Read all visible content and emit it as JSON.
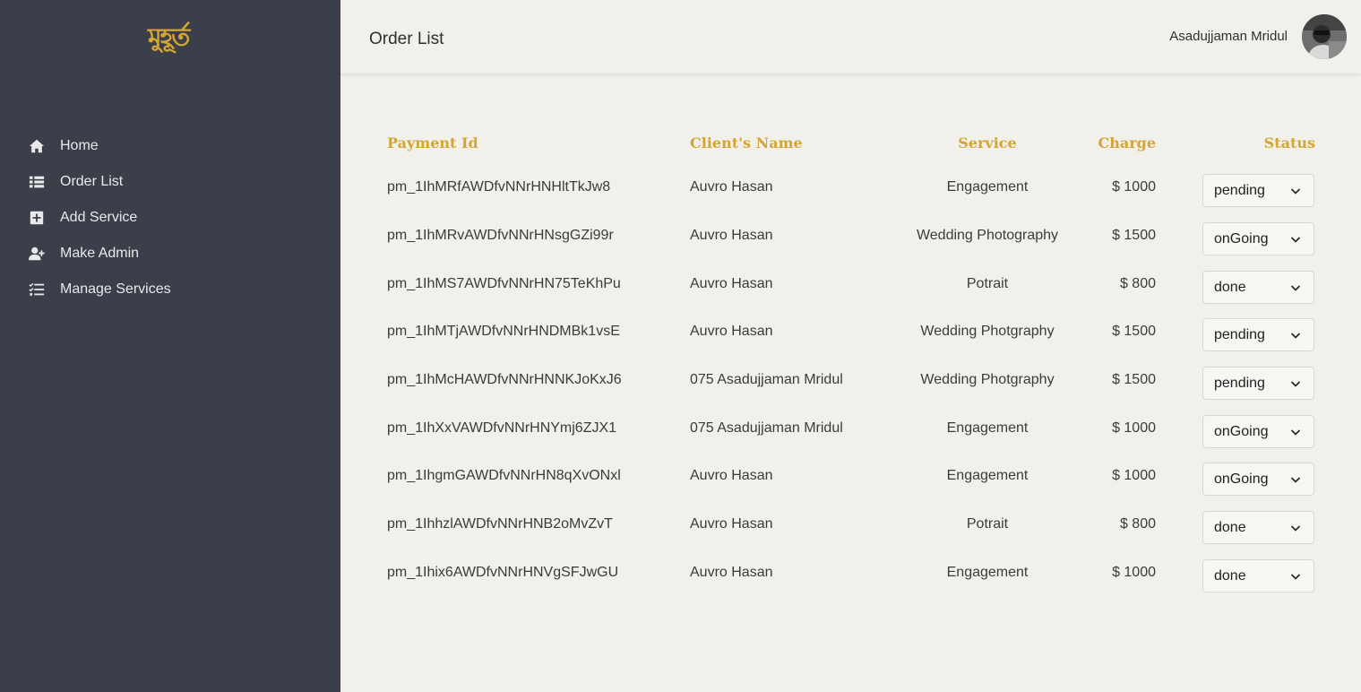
{
  "sidebar": {
    "logo_text": "মুহূর্ত",
    "items": [
      {
        "label": "Home",
        "icon": "home-icon"
      },
      {
        "label": "Order List",
        "icon": "list-icon"
      },
      {
        "label": "Add Service",
        "icon": "plus-square-icon"
      },
      {
        "label": "Make Admin",
        "icon": "user-plus-icon"
      },
      {
        "label": "Manage Services",
        "icon": "tasks-icon"
      }
    ]
  },
  "header": {
    "title": "Order List",
    "user_name": "Asadujjaman Mridul"
  },
  "table": {
    "columns": [
      "Payment Id",
      "Client's Name",
      "Service",
      "Charge",
      "Status"
    ],
    "rows": [
      {
        "payment_id": "pm_1IhMRfAWDfvNNrHNHltTkJw8",
        "client": "Auvro Hasan",
        "service": "Engagement",
        "charge": "$ 1000",
        "status": "pending"
      },
      {
        "payment_id": "pm_1IhMRvAWDfvNNrHNsgGZi99r",
        "client": "Auvro Hasan",
        "service": "Wedding Photography",
        "charge": "$ 1500",
        "status": "onGoing"
      },
      {
        "payment_id": "pm_1IhMS7AWDfvNNrHN75TeKhPu",
        "client": "Auvro Hasan",
        "service": "Potrait",
        "charge": "$ 800",
        "status": "done"
      },
      {
        "payment_id": "pm_1IhMTjAWDfvNNrHNDMBk1vsE",
        "client": "Auvro Hasan",
        "service": "Wedding Photgraphy",
        "charge": "$ 1500",
        "status": "pending"
      },
      {
        "payment_id": "pm_1IhMcHAWDfvNNrHNNKJoKxJ6",
        "client": "075 Asadujjaman Mridul",
        "service": "Wedding Photgraphy",
        "charge": "$ 1500",
        "status": "pending"
      },
      {
        "payment_id": "pm_1IhXxVAWDfvNNrHNYmj6ZJX1",
        "client": "075 Asadujjaman Mridul",
        "service": "Engagement",
        "charge": "$ 1000",
        "status": "onGoing"
      },
      {
        "payment_id": "pm_1IhgmGAWDfvNNrHN8qXvONxl",
        "client": "Auvro Hasan",
        "service": "Engagement",
        "charge": "$ 1000",
        "status": "onGoing"
      },
      {
        "payment_id": "pm_1IhhzlAWDfvNNrHNB2oMvZvT",
        "client": "Auvro Hasan",
        "service": "Potrait",
        "charge": "$ 800",
        "status": "done"
      },
      {
        "payment_id": "pm_1Ihix6AWDfvNNrHNVgSFJwGU",
        "client": "Auvro Hasan",
        "service": "Engagement",
        "charge": "$ 1000",
        "status": "done"
      }
    ]
  },
  "colors": {
    "sidebar_bg": "#3b3f4a",
    "accent": "#d4a535",
    "page_bg": "#f2f0eb"
  }
}
